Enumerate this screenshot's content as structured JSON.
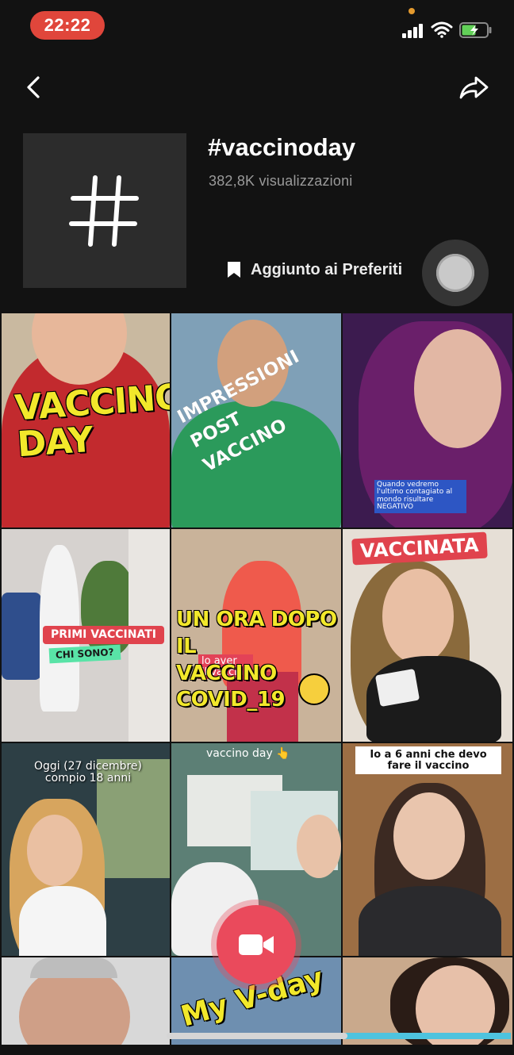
{
  "status_bar": {
    "time": "22:22",
    "icons": [
      "signal-icon",
      "wifi-icon",
      "battery-charging-icon"
    ],
    "time_pill_color": "#e0463b"
  },
  "header": {
    "back_icon": "chevron-left-icon",
    "share_icon": "share-arrow-icon",
    "hashtag_symbol": "#",
    "title": "#vaccinoday",
    "views": "382,8K visualizzazioni",
    "favorite_label": "Aggiunto ai Preferiti",
    "favorite_icon": "bookmark-icon"
  },
  "videos": [
    {
      "caption": "VACCINO\nDAY"
    },
    {
      "caption": "IMPRESSIONI\nPOST\nVACCINO"
    },
    {
      "caption": "Quando vedremo l'ultimo contagiato al mondo risultare NEGATIVO"
    },
    {
      "caption": "PRIMI VACCINATI",
      "subcaption": "CHI SONO?"
    },
    {
      "caption": "UN ORA DOPO IL\nVACCINO\nCOVID_19",
      "overlay": "lo      aver\nil vaccino"
    },
    {
      "caption": "VACCINATA"
    },
    {
      "caption": "Oggi (27 dicembre)\ncompio 18 anni"
    },
    {
      "caption": "vaccino day 👆"
    },
    {
      "caption": "Io a 6 anni che devo fare il vaccino"
    },
    {
      "caption": ""
    },
    {
      "caption": "My V-day"
    },
    {
      "caption": ""
    }
  ],
  "record_button": {
    "icon": "video-camera-icon",
    "color": "#ea4a5c"
  },
  "colors": {
    "background": "#121212",
    "accent": "#ea4a5c",
    "caption_yellow": "#f2e82b"
  }
}
